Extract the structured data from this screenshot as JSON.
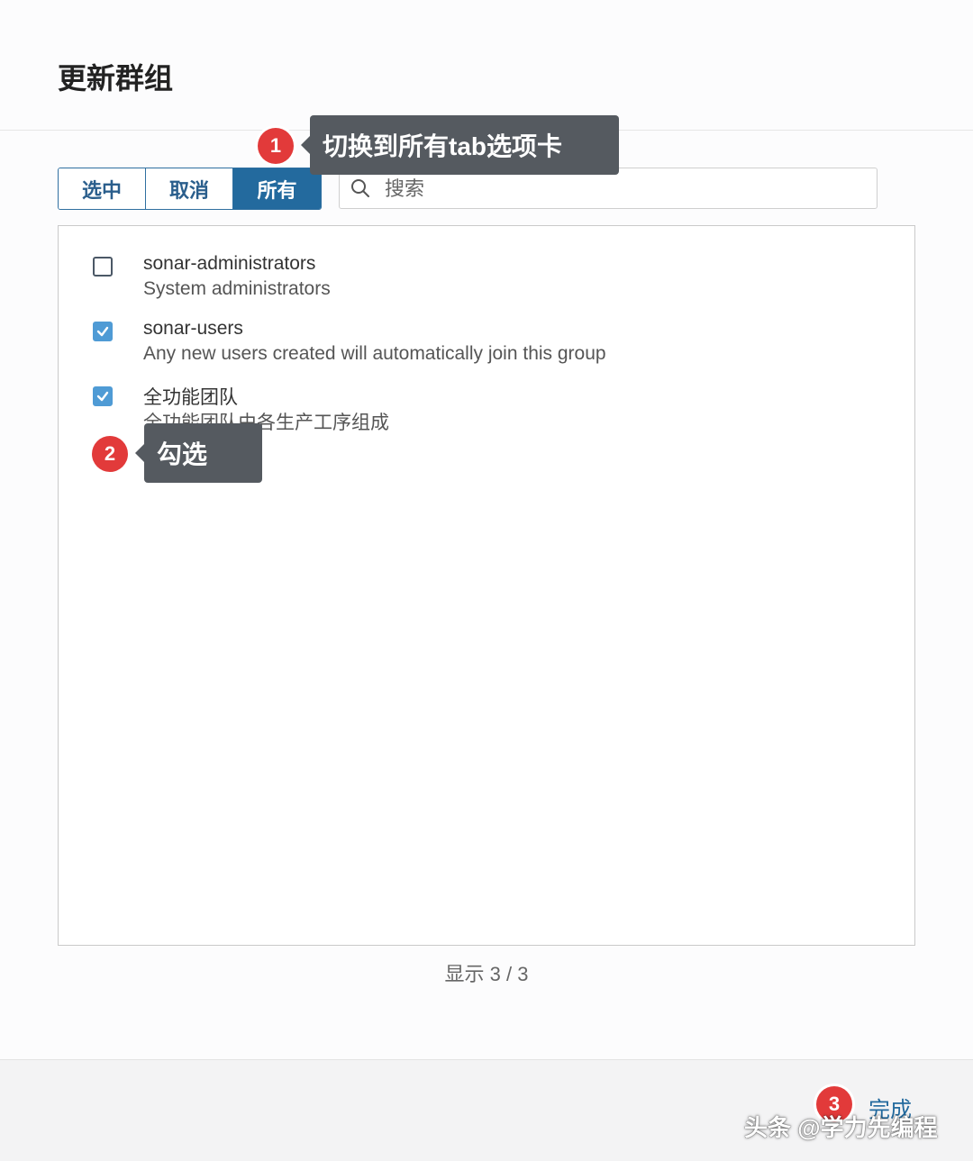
{
  "modal": {
    "title": "更新群组"
  },
  "filter": {
    "tabs": [
      {
        "label": "选中",
        "active": false
      },
      {
        "label": "取消",
        "active": false
      },
      {
        "label": "所有",
        "active": true
      }
    ]
  },
  "search": {
    "placeholder": "搜索",
    "value": ""
  },
  "groups": [
    {
      "name": "sonar-administrators",
      "description": "System administrators",
      "checked": false
    },
    {
      "name": "sonar-users",
      "description": "Any new users created will automatically join this group",
      "checked": true
    },
    {
      "name": "全功能团队",
      "description": "全功能团队由各生产工序组成",
      "checked": true
    }
  ],
  "count_text": "显示 3 / 3",
  "footer": {
    "done_label": "完成"
  },
  "annotations": [
    {
      "number": "1",
      "text": "切换到所有tab选项卡"
    },
    {
      "number": "2",
      "text": "勾选"
    },
    {
      "number": "3",
      "text": ""
    }
  ],
  "watermark": "头条 @学力先编程",
  "colors": {
    "primary": "#236a9e",
    "checkbox_checked": "#4f9bd5",
    "badge": "#e23a3a",
    "tooltip": "#555a60"
  },
  "icons": {
    "search": "search-icon",
    "check": "check-icon"
  }
}
